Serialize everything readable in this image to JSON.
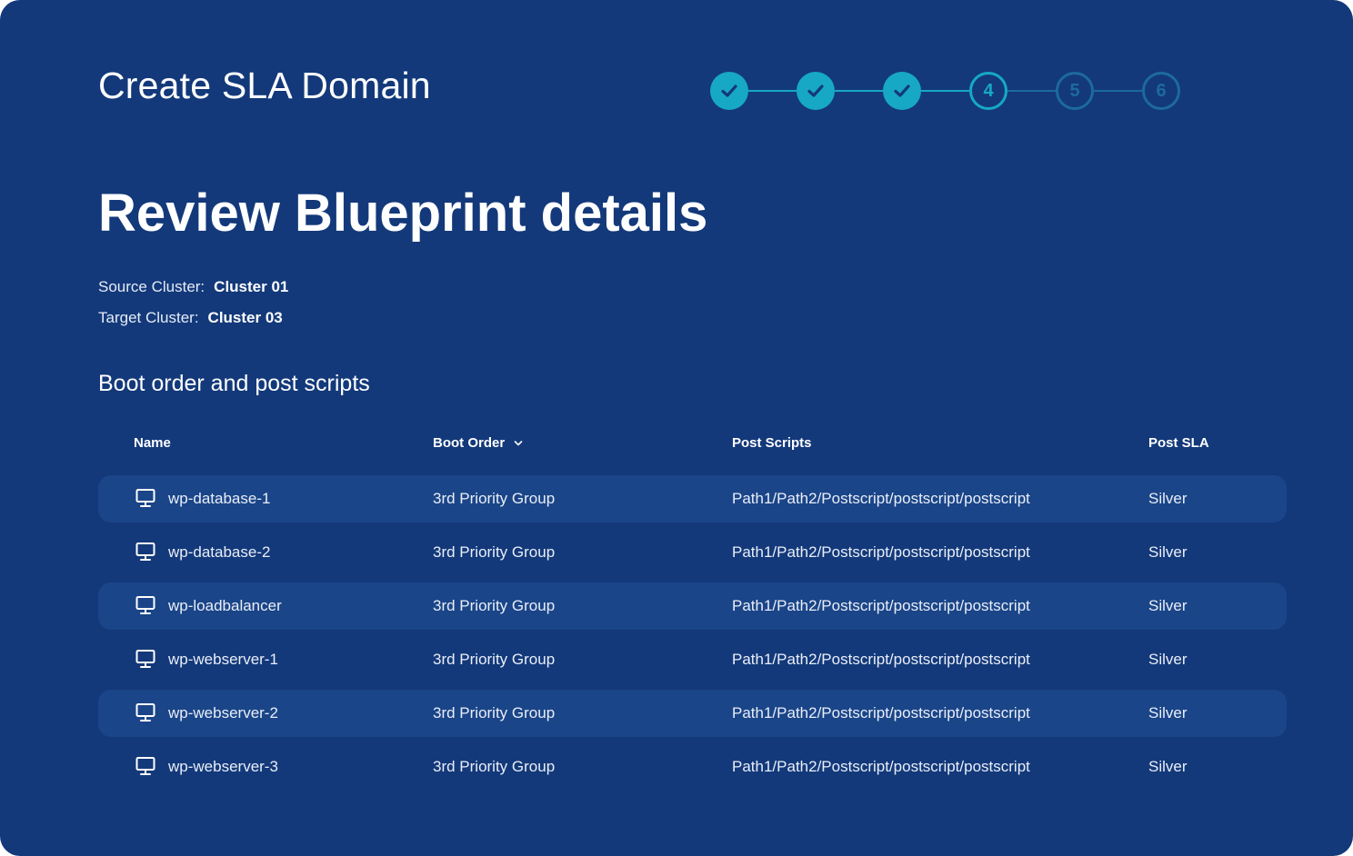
{
  "header": {
    "window_title": "Create SLA Domain"
  },
  "stepper": {
    "steps": [
      {
        "label": "",
        "state": "done",
        "icon": "check-icon"
      },
      {
        "label": "",
        "state": "done",
        "icon": "check-icon"
      },
      {
        "label": "",
        "state": "done",
        "icon": "check-icon"
      },
      {
        "label": "4",
        "state": "active"
      },
      {
        "label": "5",
        "state": "todo"
      },
      {
        "label": "6",
        "state": "todo"
      }
    ]
  },
  "page": {
    "title": "Review Blueprint details",
    "source_cluster_label": "Source Cluster:",
    "source_cluster_value": "Cluster 01",
    "target_cluster_label": "Target Cluster:",
    "target_cluster_value": "Cluster 03",
    "section_title": "Boot order and post scripts"
  },
  "table": {
    "columns": {
      "name": "Name",
      "boot_order": "Boot Order",
      "post_scripts": "Post Scripts",
      "post_sla": "Post SLA"
    },
    "rows": [
      {
        "name": "wp-database-1",
        "boot_order": "3rd Priority Group",
        "post_script": "Path1/Path2/Postscript/postscript/postscript",
        "post_sla": "Silver"
      },
      {
        "name": "wp-database-2",
        "boot_order": "3rd Priority Group",
        "post_script": "Path1/Path2/Postscript/postscript/postscript",
        "post_sla": "Silver"
      },
      {
        "name": "wp-loadbalancer",
        "boot_order": "3rd Priority Group",
        "post_script": "Path1/Path2/Postscript/postscript/postscript",
        "post_sla": "Silver"
      },
      {
        "name": "wp-webserver-1",
        "boot_order": "3rd Priority Group",
        "post_script": "Path1/Path2/Postscript/postscript/postscript",
        "post_sla": "Silver"
      },
      {
        "name": "wp-webserver-2",
        "boot_order": "3rd Priority Group",
        "post_script": "Path1/Path2/Postscript/postscript/postscript",
        "post_sla": "Silver"
      },
      {
        "name": "wp-webserver-3",
        "boot_order": "3rd Priority Group",
        "post_script": "Path1/Path2/Postscript/postscript/postscript",
        "post_sla": "Silver"
      }
    ]
  },
  "colors": {
    "background": "#13397a",
    "accent": "#17a8c6",
    "step_todo": "#1d6a9c",
    "row_stripe": "#1a4588",
    "text": "#ffffff"
  }
}
